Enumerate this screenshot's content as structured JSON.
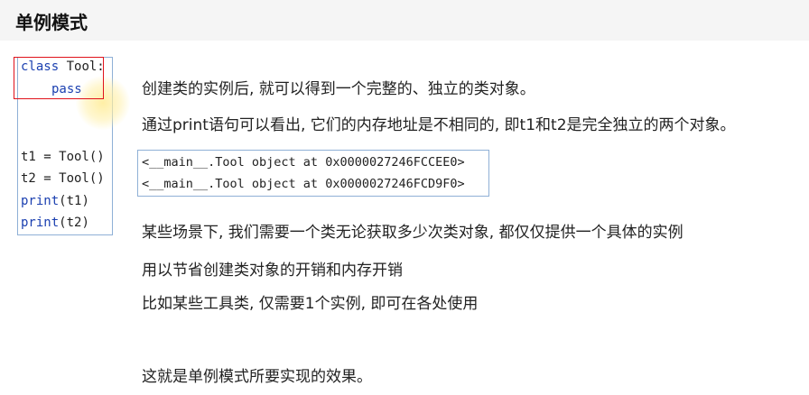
{
  "header": {
    "title": "单例模式"
  },
  "code": {
    "lines": {
      "class_kw": "class",
      "class_rest": " Tool:",
      "pass": "pass",
      "t1": "t1 = Tool()",
      "t2": "t2 = Tool()",
      "print_fn": "print",
      "print1_arg": "(t1)",
      "print2_arg": "(t2)"
    }
  },
  "text": {
    "line1": "创建类的实例后, 就可以得到一个完整的、独立的类对象。",
    "line2": "通过print语句可以看出, 它们的内存地址是不相同的, 即t1和t2是完全独立的两个对象。",
    "output1": "<__main__.Tool object at 0x0000027246FCCEE0>",
    "output2": "<__main__.Tool object at 0x0000027246FCD9F0>",
    "line3": "某些场景下, 我们需要一个类无论获取多少次类对象, 都仅仅提供一个具体的实例",
    "line4": "用以节省创建类对象的开销和内存开销",
    "line5": "比如某些工具类, 仅需要1个实例, 即可在各处使用",
    "line6": "这就是单例模式所要实现的效果。"
  }
}
